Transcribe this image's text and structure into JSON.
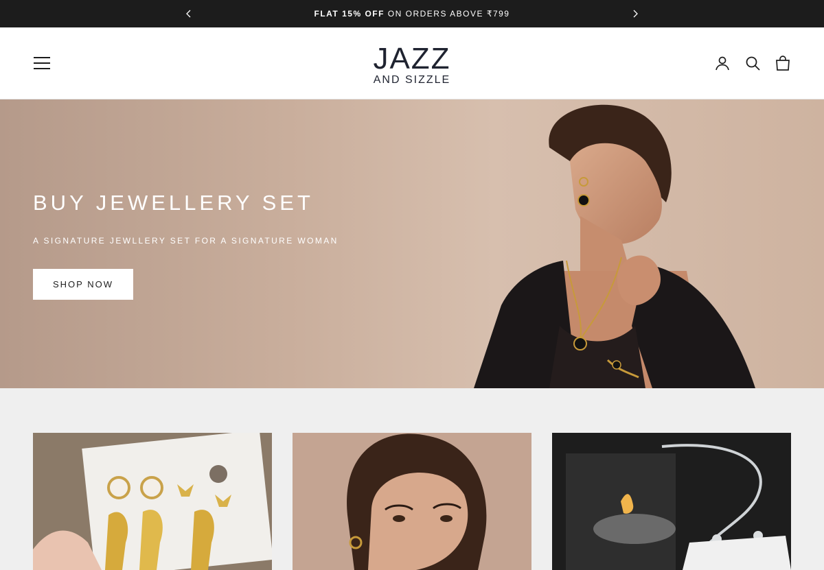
{
  "announcement": {
    "bold": "FLAT 15% OFF",
    "rest": " ON ORDERS ABOVE ₹799"
  },
  "header": {
    "logo_line1": "JAZZ",
    "logo_line2": "AND SIZZLE",
    "icons": [
      "account-icon",
      "search-icon",
      "cart-icon"
    ]
  },
  "hero": {
    "title": "BUY JEWELLERY SET",
    "subtitle": "A SIGNATURE JEWLLERY SET FOR A SIGNATURE WOMAN",
    "button_label": "SHOP NOW",
    "slide_count": 5,
    "active_slide": 1
  },
  "colors": {
    "announcement_bg": "#1c1c1c",
    "header_bg": "#ffffff",
    "page_bg": "#efefef",
    "logo": "#1f2330"
  }
}
